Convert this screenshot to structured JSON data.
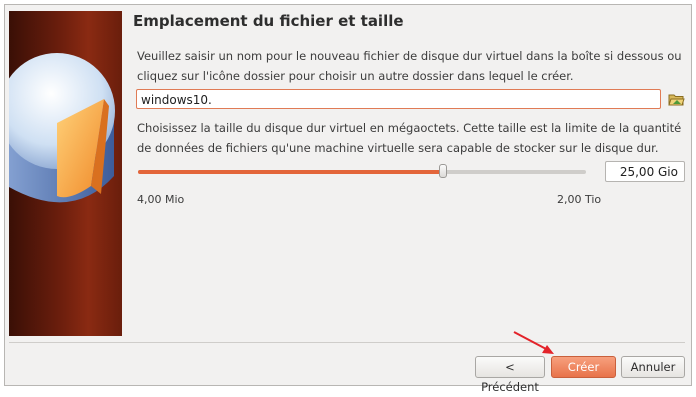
{
  "page": {
    "title": "Emplacement du fichier et taille",
    "file_instruction": "Veuillez saisir un nom pour le nouveau fichier de disque dur virtuel dans la boîte si dessous ou cliquez sur l'icône dossier pour choisir un autre dossier dans lequel le créer.",
    "file_name_value": "windows10.",
    "size_instruction": "Choisissez la taille du disque dur virtuel en mégaoctets. Cette taille est la limite de la quantité de données de fichiers qu'une machine virtuelle sera capable de stocker sur le disque dur.",
    "size_value": "25,00 Gio",
    "slider_min_label": "4,00 Mio",
    "slider_max_label": "2,00 Tio",
    "slider_fraction": 0.68
  },
  "buttons": {
    "previous": "< Précédent",
    "create": "Créer",
    "cancel": "Annuler"
  },
  "icons": {
    "folder": "folder-open-icon",
    "banner": "hard-disk-pie-icon",
    "annotation": "red-arrow-icon"
  },
  "colors": {
    "accent": "#e3653a",
    "create_button": "#e8734a",
    "arrow": "#e3232a"
  }
}
